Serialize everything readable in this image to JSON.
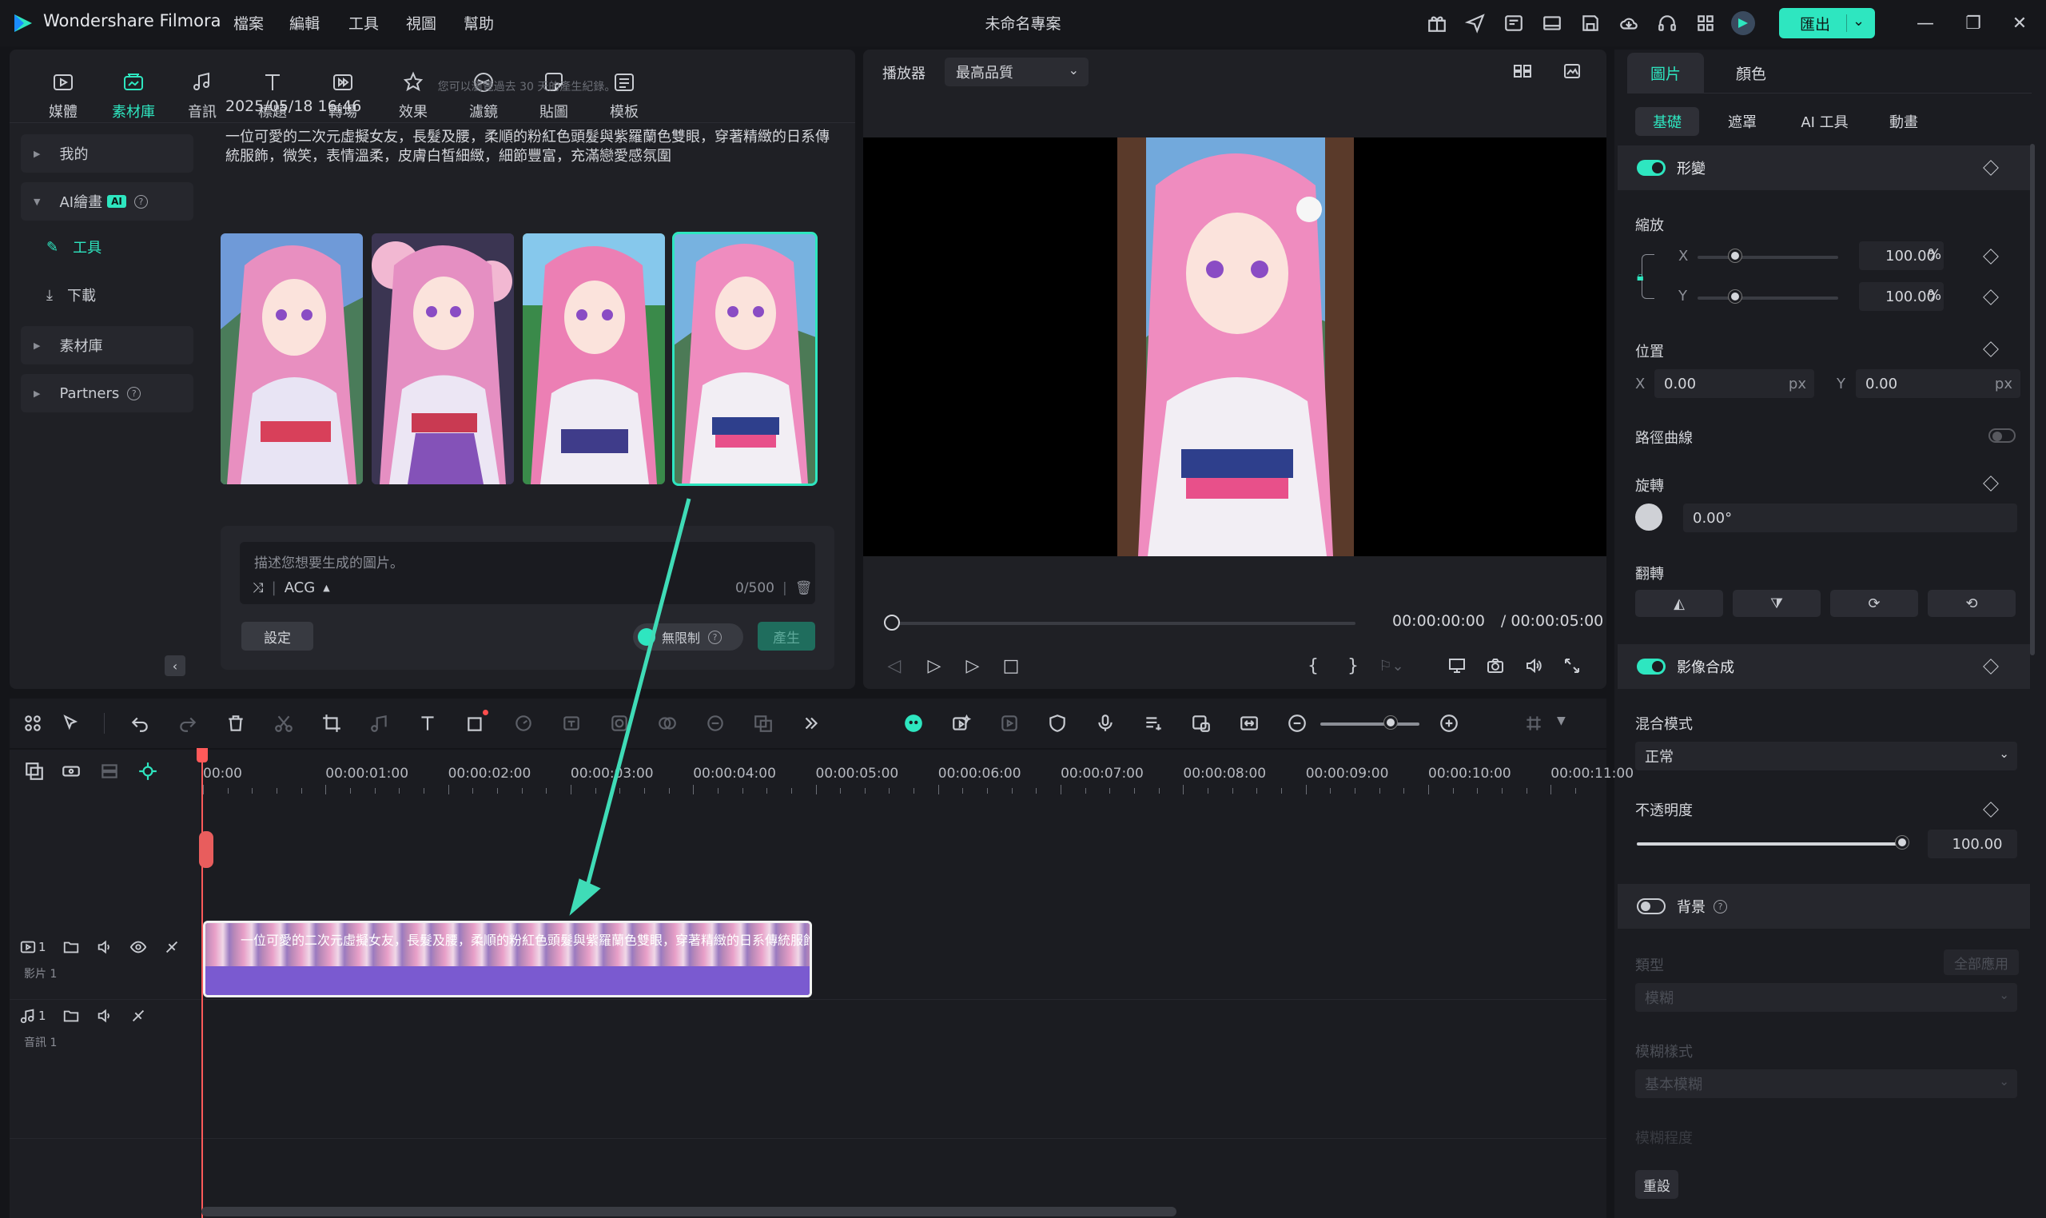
{
  "app": {
    "name": "Wondershare Filmora",
    "project_title": "未命名專案",
    "export_label": "匯出"
  },
  "menu": [
    "檔案",
    "編輯",
    "工具",
    "視圖",
    "幫助"
  ],
  "title_icons": [
    "gift-icon",
    "send-icon",
    "layout-icon",
    "monitor-icon",
    "save-icon",
    "cloud-icon",
    "headset-icon",
    "apps-icon",
    "avatar-icon"
  ],
  "media_tabs": [
    {
      "label": "媒體",
      "icon": "media-icon"
    },
    {
      "label": "素材庫",
      "icon": "library-icon"
    },
    {
      "label": "音訊",
      "icon": "music-icon"
    },
    {
      "label": "標題",
      "icon": "title-icon"
    },
    {
      "label": "轉場",
      "icon": "transition-icon"
    },
    {
      "label": "效果",
      "icon": "effects-icon"
    },
    {
      "label": "濾鏡",
      "icon": "filter-icon"
    },
    {
      "label": "貼圖",
      "icon": "sticker-icon"
    },
    {
      "label": "模板",
      "icon": "template-icon"
    }
  ],
  "sidebar": {
    "mine": "我的",
    "ai_drawing": "AI繪畫",
    "ai_badge": "AI",
    "tools": "工具",
    "download": "下載",
    "library": "素材庫",
    "partners": "Partners"
  },
  "gallery": {
    "hint": "您可以瀏覽過去 30 天的產生紀錄。",
    "date": "2025/05/18 16:46",
    "prompt": "一位可愛的二次元虛擬女友，長髮及腰，柔順的粉紅色頭髮與紫羅蘭色雙眼，穿著精緻的日系傳統服飾，微笑，表情溫柔，皮膚白皙細緻，細節豐富，充滿戀愛感氛圍"
  },
  "generator": {
    "placeholder": "描述您想要生成的圖片。",
    "style": "ACG",
    "count": "0/500",
    "settings": "設定",
    "unlimited": "無限制",
    "produce": "產生"
  },
  "player": {
    "label": "播放器",
    "quality": "最高品質",
    "current_time": "00:00:00:00",
    "total_time": "/  00:00:05:00"
  },
  "properties": {
    "tabs": {
      "picture": "圖片",
      "color": "顏色"
    },
    "subtabs": [
      "基礎",
      "遮罩",
      "AI 工具",
      "動畫"
    ],
    "transform": "形變",
    "scale": "縮放",
    "scale_x": "100.00",
    "scale_y": "100.00",
    "percent": "%",
    "position": "位置",
    "pos_x": "0.00",
    "pos_y": "0.00",
    "px": "px",
    "x": "X",
    "y": "Y",
    "path_curve": "路徑曲線",
    "rotation": "旋轉",
    "rotation_value": "0.00°",
    "flip": "翻轉",
    "compositing": "影像合成",
    "blend_mode": "混合模式",
    "blend_value": "正常",
    "opacity": "不透明度",
    "opacity_value": "100.00",
    "opacity_level": 1.0,
    "background": "背景",
    "bg_type": "類型",
    "apply_all": "全部應用",
    "bg_type_value": "模糊",
    "blur_style": "模糊樣式",
    "blur_style_value": "基本模糊",
    "blur_level": "模糊程度",
    "reset": "重設"
  },
  "timeline": {
    "ruler": [
      "00:00",
      "00:00:01:00",
      "00:00:02:00",
      "00:00:03:00",
      "00:00:04:00",
      "00:00:05:00",
      "00:00:06:00",
      "00:00:07:00",
      "00:00:08:00",
      "00:00:09:00",
      "00:00:10:00",
      "00:00:11:00"
    ],
    "video_track": "影片 1",
    "audio_track": "音訊 1",
    "video_num": "1",
    "audio_num": "1",
    "clip_label": "一位可愛的二次元虛擬女友，長髮及腰，柔順的粉紅色頭髮與紫羅蘭色雙眼，穿著精緻的日系傳統服飾"
  },
  "colors": {
    "accent": "#2ee6c0",
    "clip": "#7a5ad0",
    "playhead": "#ff5a5a"
  }
}
